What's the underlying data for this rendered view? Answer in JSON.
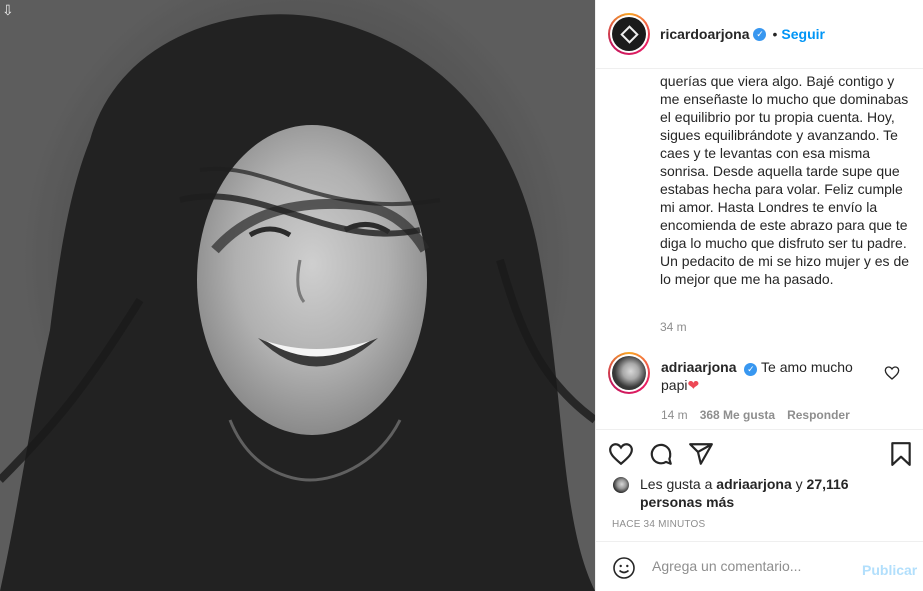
{
  "post": {
    "username": "ricardoarjona",
    "follow_label": "Seguir",
    "separator": "•",
    "caption": "querías que viera algo. Bajé contigo y me enseñaste lo mucho que dominabas el equilibrio por tu propia cuenta. Hoy, sigues equilibrándote y avanzando. Te caes y te levantas con esa misma sonrisa. Desde aquella tarde supe que estabas hecha para volar. Feliz cumple mi amor. Hasta Londres te envío la encomienda de este abrazo para que te diga lo mucho que disfruto ser tu padre. Un pedacito de mi se hizo mujer y es de lo mejor que me ha pasado.",
    "caption_time": "34 m",
    "verified_icon": "verified-badge-icon"
  },
  "comment": {
    "username": "adriaarjona",
    "text": "Te amo mucho papi",
    "emoji": "❤",
    "time": "14 m",
    "likes": "368 Me gusta",
    "reply_label": "Responder"
  },
  "likes": {
    "prefix": "Les gusta a",
    "user": "adriaarjona",
    "conjunction": "y",
    "count": "27,116 personas más"
  },
  "timestamp": "HACE 34 MINUTOS",
  "comment_box": {
    "placeholder": "Agrega un comentario...",
    "publish_label": "Publicar"
  },
  "colors": {
    "accent": "#0095f6",
    "verified": "#3897f0",
    "heart": "#ed4956",
    "publish_disabled": "#b2dffc",
    "meta_gray": "#8e8e8e"
  }
}
